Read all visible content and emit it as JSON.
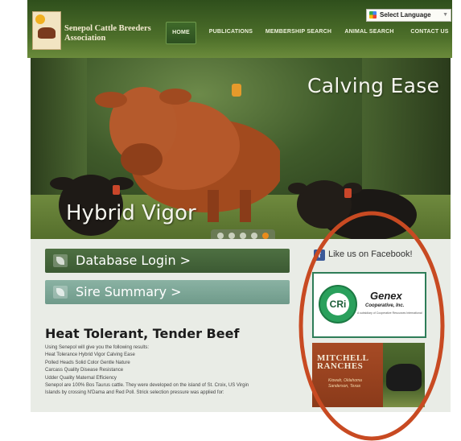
{
  "header": {
    "org_name": "Senepol Cattle Breeders Association",
    "language_label": "Select Language",
    "nav": [
      {
        "label": "HOME",
        "active": true
      },
      {
        "label": "PUBLICATIONS"
      },
      {
        "label": "MEMBERSHIP SEARCH"
      },
      {
        "label": "ANIMAL SEARCH"
      },
      {
        "label": "CONTACT US"
      }
    ]
  },
  "hero": {
    "caption_top": "Calving Ease",
    "caption_bottom": "Hybrid Vigor",
    "slides": 5,
    "active_slide": 5
  },
  "buttons": {
    "database_login": "Database Login >",
    "sire_summary": "Sire Summary >"
  },
  "article": {
    "heading": "Heat Tolerant, Tender Beef",
    "lines": [
      "Using Senepol will give you the following results:",
      "Heat Tolerance Hybrid Vigor Calving Ease",
      "Polled Heads Solid Color Gentle Nature",
      "Carcass Quality Disease Resistance",
      "Udder Quality Maternal Efficiency",
      "Senepol are 100% Bos Taurus cattle. They were developed on the island of St. Croix, US Virgin",
      "Islands by crossing N'Dama and Red Poll. Strick selection pressure was applied for:"
    ]
  },
  "sidebar": {
    "facebook_text": "Like us on Facebook!",
    "genex": {
      "seal_text": "CRi",
      "name": "Genex",
      "subtitle": "Cooperative, Inc.",
      "tagline": "A subsidiary of Cooperative Resources International"
    },
    "mitchell": {
      "name_line1": "MITCHELL",
      "name_line2": "RANCHES",
      "location_line1": "Kiowah, Oklahoma",
      "location_line2": "Sanderson, Texas"
    }
  },
  "colors": {
    "header_green": "#4d6f2a",
    "db_button": "#4e7042",
    "sire_button": "#8ab2a3",
    "annotation_red": "#c84a22",
    "slider_active": "#e88c1d"
  }
}
